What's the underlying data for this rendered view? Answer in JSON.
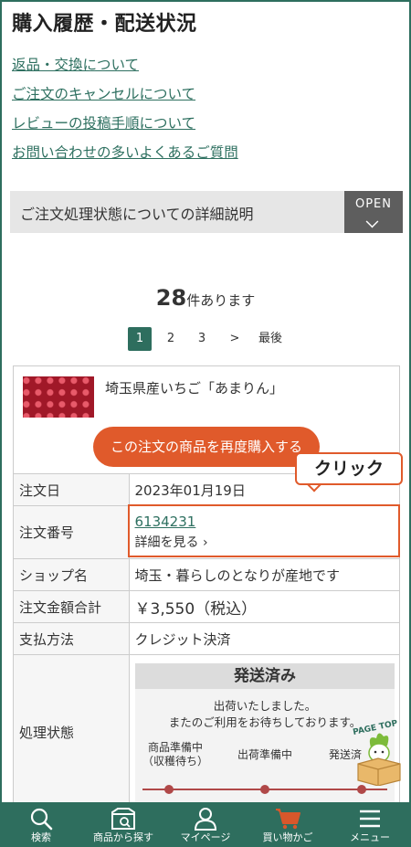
{
  "page_title": "購入履歴・配送状況",
  "links": [
    "返品・交換について",
    "ご注文のキャンセルについて",
    "レビューの投稿手順について",
    "お問い合わせの多いよくあるご質問"
  ],
  "accordion": {
    "label": "ご注文処理状態についての詳細説明",
    "button": "OPEN"
  },
  "result": {
    "count": "28",
    "suffix": "件あります"
  },
  "pagination": {
    "pages": [
      "1",
      "2",
      "3"
    ],
    "current": "1",
    "next": ">",
    "last": "最後"
  },
  "order": {
    "product_name": "埼玉県産いちご「あまりん」",
    "rebuy_label": "この注文の商品を再度購入する",
    "rows": {
      "date": {
        "label": "注文日",
        "value": "2023年01月19日"
      },
      "number": {
        "label": "注文番号",
        "value": "6134231",
        "detail": "詳細を見る ›"
      },
      "shop": {
        "label": "ショップ名",
        "value": "埼玉・暮らしのとなりが産地です"
      },
      "total": {
        "label": "注文金額合計",
        "value": "￥3,550（税込）"
      },
      "payment": {
        "label": "支払方法",
        "value": "クレジット決済"
      },
      "status": {
        "label": "処理状態"
      }
    },
    "status_box": {
      "head": "発送済み",
      "message_1": "出荷いたしました。",
      "message_2": "またのご利用をお待ちしております。",
      "step_1_line1": "商品準備中",
      "step_1_line2": "（収穫待ち）",
      "step_2": "出荷準備中",
      "step_3": "発送済"
    }
  },
  "callout": "クリック",
  "page_top": "PAGE TOP",
  "nav": [
    "検索",
    "商品から探す",
    "マイページ",
    "買い物かご",
    "メニュー"
  ],
  "colors": {
    "primary": "#2e6e5e",
    "accent": "#e05a2b",
    "link": "#2e7060"
  }
}
